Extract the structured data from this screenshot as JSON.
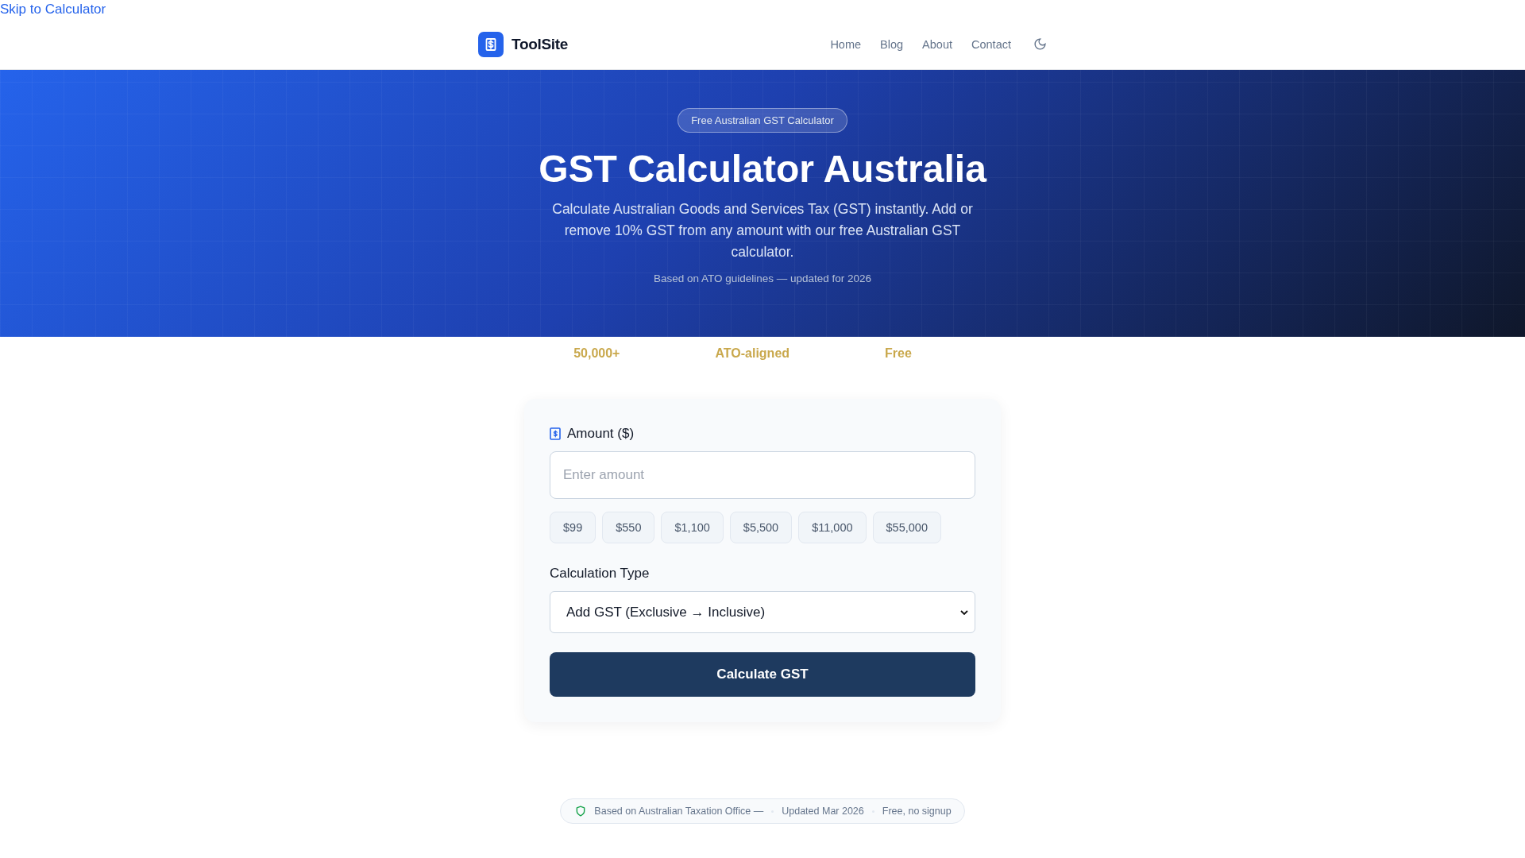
{
  "skip_link": "Skip to Calculator",
  "header": {
    "logo": "ToolSite",
    "nav": [
      "Home",
      "Blog",
      "About",
      "Contact"
    ]
  },
  "hero": {
    "badge": "Free Australian GST Calculator",
    "title": "GST Calculator Australia",
    "description": "Calculate Australian Goods and Services Tax (GST) instantly. Add or remove 10% GST from any amount with our free Australian GST calculator.",
    "note": "Based on ATO guidelines — updated for 2026"
  },
  "stats": [
    "50,000+",
    "ATO-aligned",
    "Free"
  ],
  "calculator": {
    "amount_label": "Amount ($)",
    "amount_placeholder": "Enter amount",
    "presets": [
      "$99",
      "$550",
      "$1,100",
      "$5,500",
      "$11,000",
      "$55,000"
    ],
    "type_label": "Calculation Type",
    "type_value": "Add GST (Exclusive → Inclusive)",
    "button": "Calculate GST"
  },
  "trust_bar": [
    "Based on Australian Taxation Office —",
    "Updated Mar 2026",
    "Free, no signup"
  ]
}
